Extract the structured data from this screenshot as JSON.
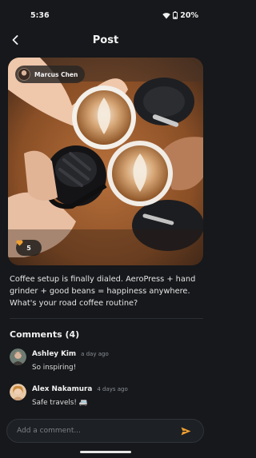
{
  "status_bar": {
    "time": "5:36",
    "battery": "20%",
    "icons": [
      "wifi-icon",
      "battery-icon"
    ]
  },
  "header": {
    "title": "Post",
    "back_icon": "back-arrow-icon"
  },
  "post": {
    "author": "Marcus Chen",
    "likes": "5",
    "caption": "Coffee setup is finally dialed. AeroPress + hand grinder + good beans = happiness anywhere. What's your road coffee routine?"
  },
  "comments": {
    "heading": "Comments (4)",
    "items": [
      {
        "author": "Ashley Kim",
        "time": "a day ago",
        "text": "So inspiring!"
      },
      {
        "author": "Alex Nakamura",
        "time": "4 days ago",
        "text": "Safe travels! 🚐"
      }
    ]
  },
  "composer": {
    "placeholder": "Add a comment...",
    "send_icon": "send-icon"
  },
  "colors": {
    "background": "#16181b",
    "accent": "#f0a030",
    "like": "#f0a030"
  }
}
